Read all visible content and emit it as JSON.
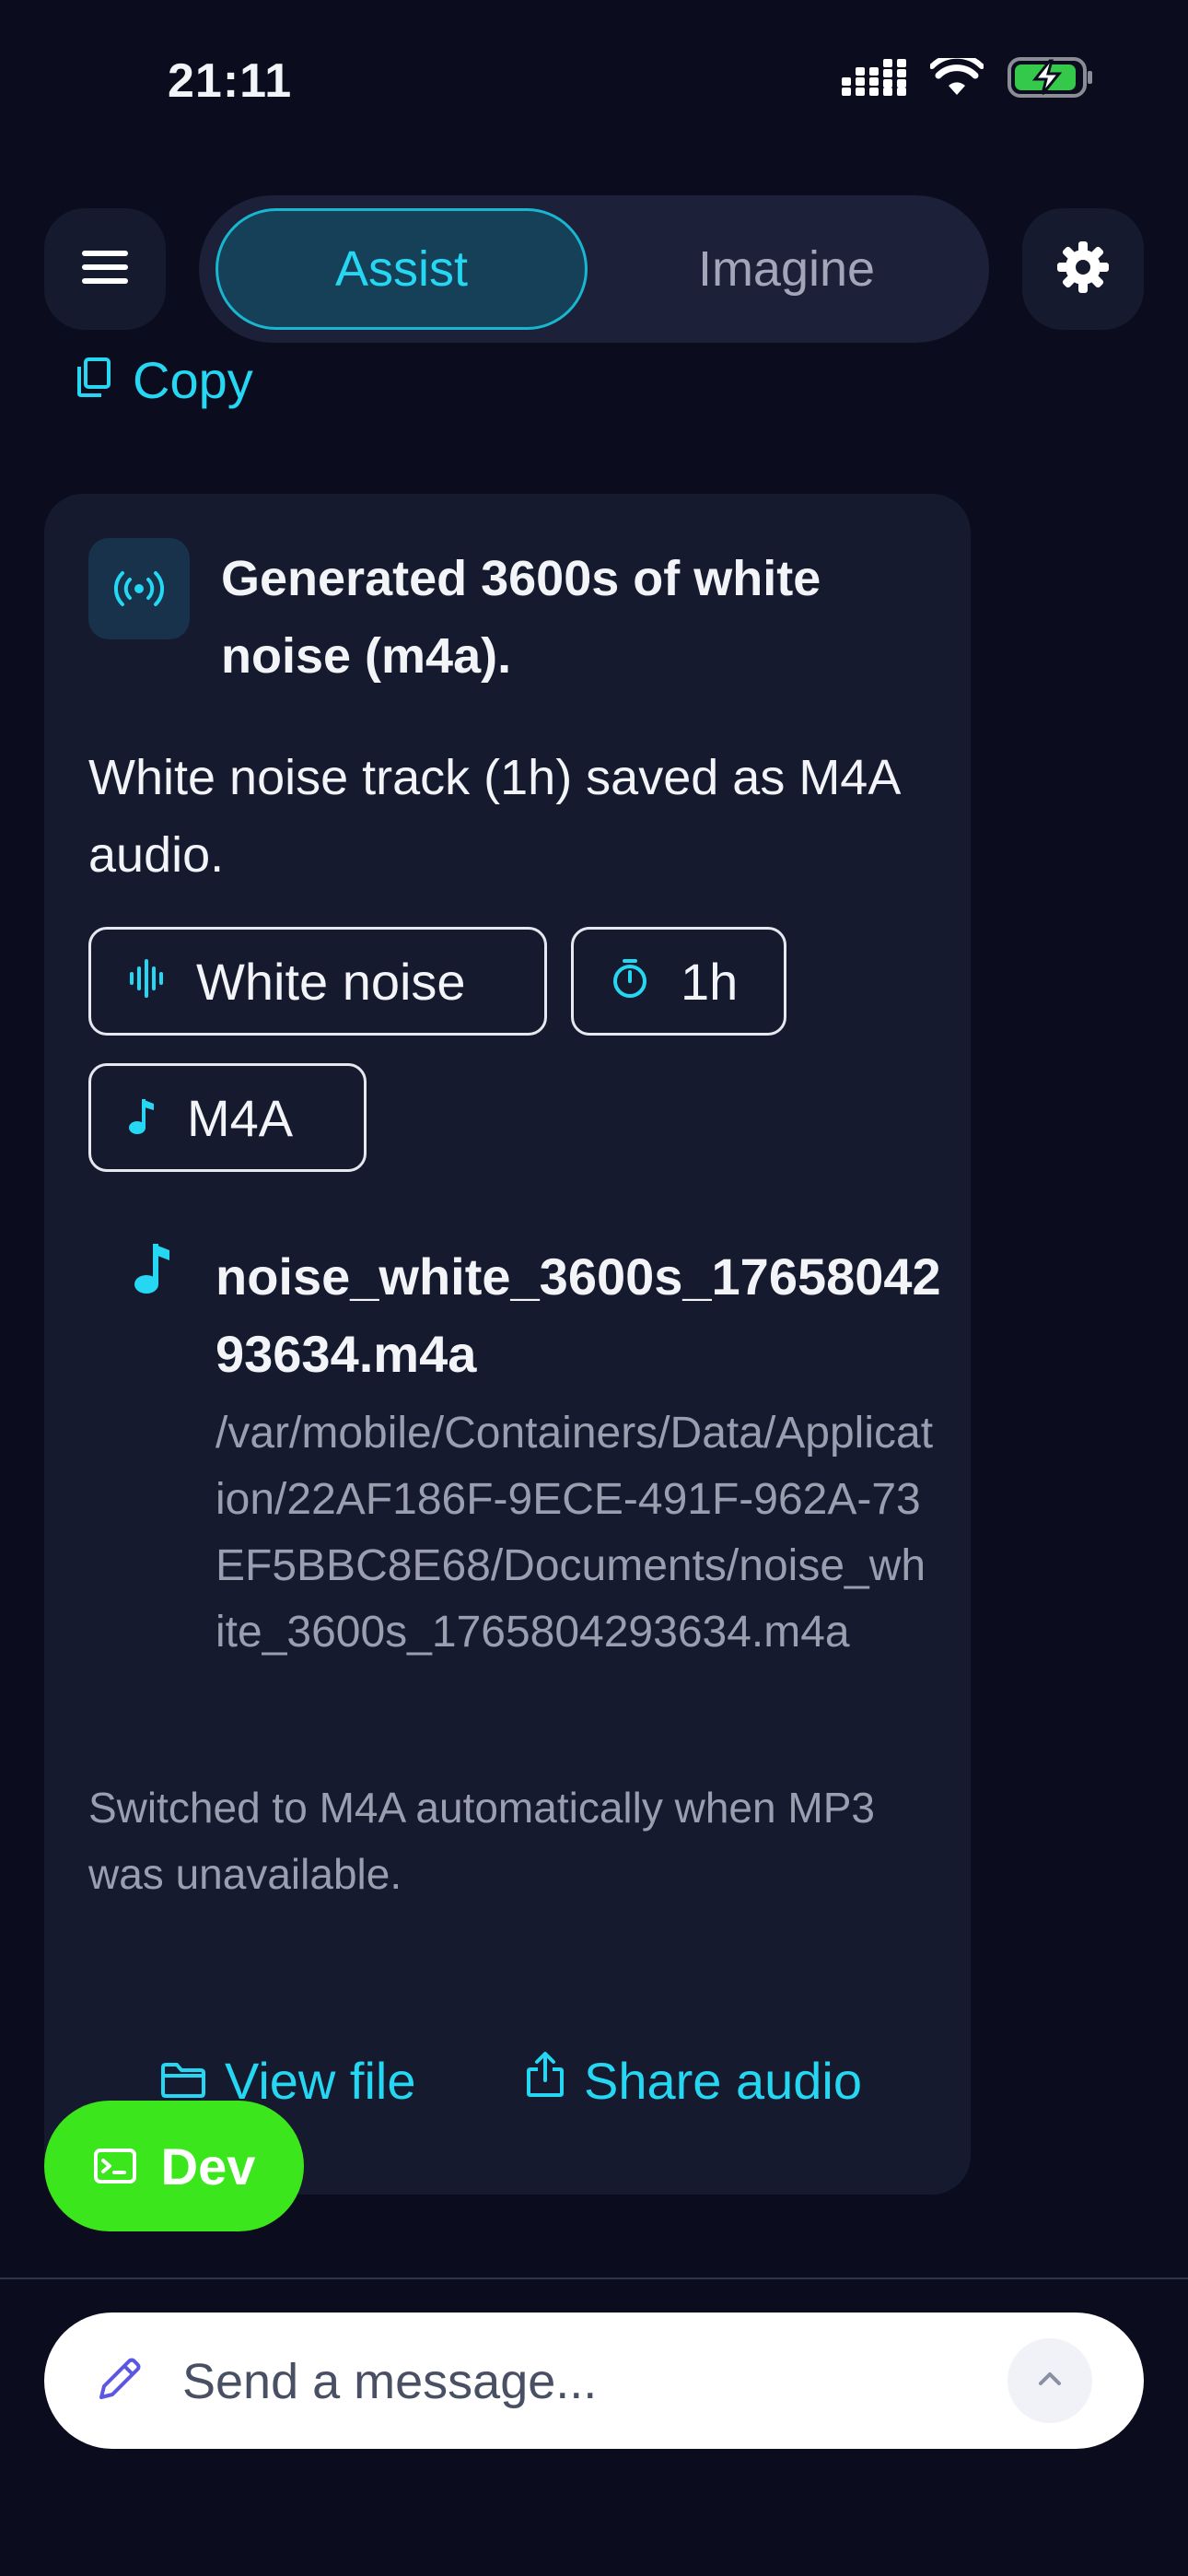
{
  "status_bar": {
    "time": "21:11"
  },
  "header": {
    "tabs": [
      {
        "label": "Assist",
        "active": true
      },
      {
        "label": "Imagine",
        "active": false
      }
    ]
  },
  "copy": {
    "label": "Copy"
  },
  "card": {
    "icon": "radio-broadcast-icon",
    "title": "Generated 3600s of white noise (m4a).",
    "description": "White noise track (1h) saved as M4A audio.",
    "chips": [
      {
        "icon": "waveform-icon",
        "label": "White noise"
      },
      {
        "icon": "timer-icon",
        "label": "1h"
      },
      {
        "icon": "music-note-icon",
        "label": "M4A"
      }
    ],
    "file": {
      "name": "noise_white_3600s_1765804293634.m4a",
      "path": "/var/mobile/Containers/Data/Application/22AF186F-9ECE-491F-962A-73EF5BBC8E68/Documents/noise_white_3600s_1765804293634.m4a"
    },
    "note": "Switched to M4A automatically when MP3 was unavailable.",
    "actions": {
      "view_file": "View file",
      "share_audio": "Share audio"
    }
  },
  "dev_button": {
    "label": "Dev"
  },
  "composer": {
    "placeholder": "Send a message..."
  },
  "colors": {
    "background": "#0b0d1e",
    "accent": "#25d7f2",
    "card": "#151a2f",
    "dev_green": "#3ce61c"
  }
}
